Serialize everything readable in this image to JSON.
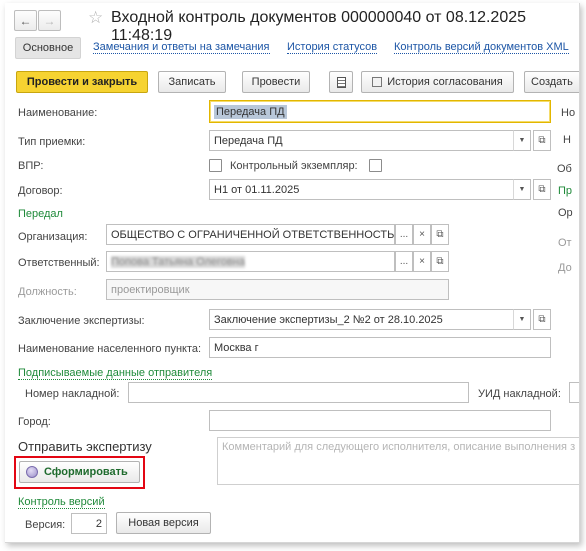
{
  "window": {
    "title": "Входной контроль документов 000000040 от 08.12.2025 11:48:19",
    "back_icon": "arrow-left-icon",
    "forward_icon": "arrow-right-icon",
    "favorite_icon": "star-icon"
  },
  "tabs": [
    {
      "label": "Основное"
    },
    {
      "label": "Замечания и ответы на замечания"
    },
    {
      "label": "История статусов"
    },
    {
      "label": "Контроль версий документов XML"
    }
  ],
  "toolbar": {
    "post_close": "Провести и закрыть",
    "save": "Записать",
    "post": "Провести",
    "report_icon": "document-list-icon",
    "approval_history": "История согласования",
    "create": "Создать"
  },
  "form": {
    "name_label": "Наименование:",
    "name_value": "Передача ПД",
    "acceptance_type_label": "Тип приемки:",
    "acceptance_type_value": "Передача ПД",
    "vpr_label": "ВПР:",
    "control_copy_label": "Контрольный экземпляр:",
    "contract_label": "Договор:",
    "contract_value": "Н1 от 01.11.2025",
    "sender_section": "Передал",
    "org_label": "Организация:",
    "org_value": "ОБЩЕСТВО С ОГРАНИЧЕННОЙ ОТВЕТСТВЕННОСТЬЮ",
    "responsible_label": "Ответственный:",
    "responsible_value": "Попова Татьяна Олеговна",
    "position_label": "Должность:",
    "position_value": "проектировщик",
    "expertise_label": "Заключение экспертизы:",
    "expertise_value": "Заключение экспертизы_2 №2 от 28.10.2025",
    "settlement_label": "Наименование населенного пункта:",
    "settlement_value": "Москва г",
    "signed_section": "Подписываемые данные отправителя",
    "waybill_label": "Номер накладной:",
    "waybill_value": "",
    "uid_label": "УИД накладной:",
    "city_label": "Город:",
    "city_value": "",
    "send_expertise_label": "Отправить экспертизу",
    "generate_button": "Сформировать",
    "comment_placeholder": "Комментарий для следующего исполнителя, описание выполнения з",
    "versions_section": "Контроль версий",
    "version_label": "Версия:",
    "version_value": "2",
    "new_version_button": "Новая версия"
  },
  "right_cut": {
    "r1": "Но",
    "r2": "Н",
    "r3": "Об",
    "r4": "Пр",
    "r5": "Ор",
    "r6": "От",
    "r7": "До"
  }
}
